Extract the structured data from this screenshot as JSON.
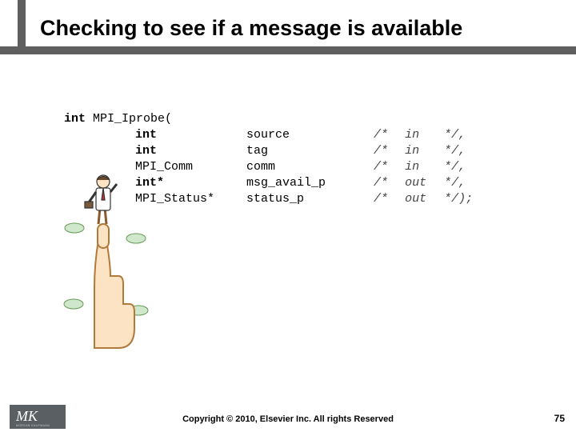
{
  "title": "Checking to see if a message is available",
  "signature": {
    "ret": "int",
    "func": "MPI_Iprobe(",
    "params": [
      {
        "type": "int",
        "name": "source",
        "c1": "/*",
        "c2": "in",
        "c3": "*/,"
      },
      {
        "type": "int",
        "name": "tag",
        "c1": "/*",
        "c2": "in",
        "c3": "*/,"
      },
      {
        "type": "MPI_Comm",
        "name": "comm",
        "c1": "/*",
        "c2": "in",
        "c3": "*/,"
      },
      {
        "type": "int*",
        "name": "msg_avail_p",
        "c1": "/*",
        "c2": "out",
        "c3": "*/,"
      },
      {
        "type": "MPI_Status*",
        "name": "status_p",
        "c1": "/*",
        "c2": "out",
        "c3": "*/);"
      }
    ]
  },
  "footer": {
    "logo_text": "MK",
    "logo_sub": "MORGAN KAUFMANN",
    "copyright": "Copyright © 2010, Elsevier Inc. All rights Reserved",
    "page": "75"
  },
  "clipart_desc": "man-standing-on-pointing-hand"
}
